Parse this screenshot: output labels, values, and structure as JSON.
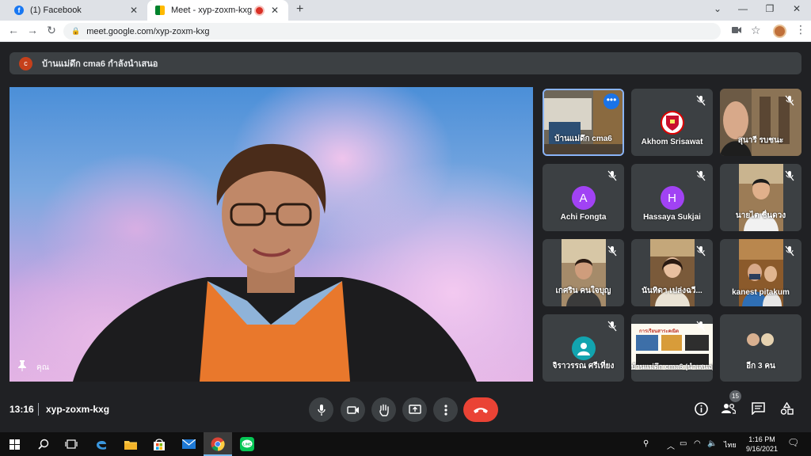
{
  "browser": {
    "tabs": [
      {
        "title": "(1) Facebook",
        "favicon": "facebook-icon"
      },
      {
        "title": "Meet - xyp-zoxm-kxg",
        "favicon": "meet-icon",
        "recording": true
      }
    ],
    "url": "meet.google.com/xyp-zoxm-kxg"
  },
  "banner": {
    "avatar_letter": "c",
    "text": "บ้านแม่ดึก cma6 กำลังนำเสนอ"
  },
  "main": {
    "you_label": "คุณ"
  },
  "participants": [
    {
      "name": "บ้านแม่ดึก cma6",
      "type": "video",
      "host": true,
      "menu": "•••"
    },
    {
      "name": "Akhom Srisawat",
      "type": "logo",
      "muted": true
    },
    {
      "name": "สุนารี รบชนะ",
      "type": "video",
      "muted": true
    },
    {
      "name": "Achi Fongta",
      "type": "avatar",
      "letter": "A",
      "color": "#a142f4",
      "muted": true
    },
    {
      "name": "Hassaya Sukjai",
      "type": "avatar",
      "letter": "H",
      "color": "#a142f4",
      "muted": true
    },
    {
      "name": "นายไต ชื่นดวง",
      "type": "video",
      "muted": true
    },
    {
      "name": "เกศริน คนใจบุญ",
      "type": "video",
      "muted": true
    },
    {
      "name": "นันทิดา เปล่งฉวี...",
      "type": "video",
      "muted": true
    },
    {
      "name": "kanest pitakum",
      "type": "video",
      "muted": true
    },
    {
      "name": "จิราวรรณ ศรีเที่ยง",
      "type": "avatar-person",
      "color": "#12a4af",
      "muted": true
    },
    {
      "name": "บ้านแม่ดึก cma6 (นำเสนอ)",
      "type": "screen",
      "muted": true,
      "screen_title": "การเรียนสาระคณิต"
    },
    {
      "name": "อีก 3 คน",
      "type": "more"
    }
  ],
  "controls": {
    "time": "13:16",
    "meeting_code": "xyp-zoxm-kxg",
    "people_count": "15"
  },
  "taskbar": {
    "time": "1:16 PM",
    "date": "9/16/2021",
    "lang": "ไทย"
  },
  "colors": {
    "meet_bg": "#202124",
    "tile_bg": "#3c4043",
    "end_call": "#ea4335",
    "host_border": "#8ab4f8"
  }
}
